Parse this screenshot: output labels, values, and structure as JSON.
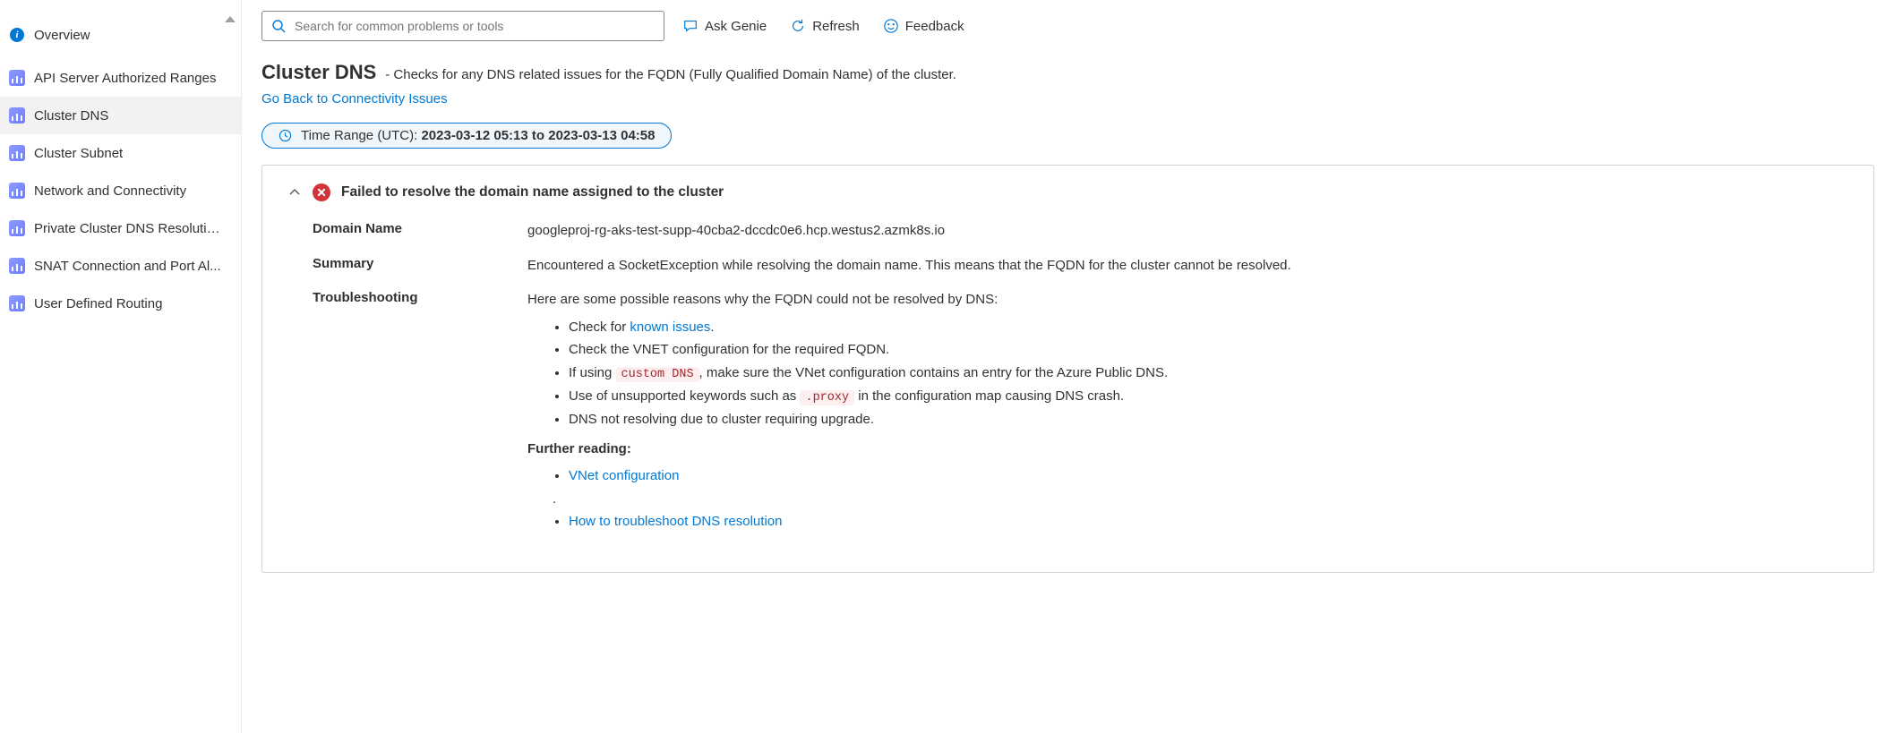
{
  "sidebar": {
    "overview": {
      "label": "Overview"
    },
    "items": [
      {
        "label": "API Server Authorized Ranges"
      },
      {
        "label": "Cluster DNS"
      },
      {
        "label": "Cluster Subnet"
      },
      {
        "label": "Network and Connectivity"
      },
      {
        "label": "Private Cluster DNS Resolutio..."
      },
      {
        "label": "SNAT Connection and Port Al..."
      },
      {
        "label": "User Defined Routing"
      }
    ],
    "selected_index": 1
  },
  "toolbar": {
    "search_placeholder": "Search for common problems or tools",
    "ask_genie": "Ask Genie",
    "refresh": "Refresh",
    "feedback": "Feedback"
  },
  "page": {
    "title": "Cluster DNS",
    "description": "-  Checks for any DNS related issues for the FQDN (Fully Qualified Domain Name) of the cluster.",
    "back_link": "Go Back to Connectivity Issues",
    "time_range_label": "Time Range (UTC): ",
    "time_range_value": "2023-03-12 05:13 to 2023-03-13 04:58"
  },
  "panel": {
    "title": "Failed to resolve the domain name assigned to the cluster",
    "rows": {
      "domain_name": {
        "label": "Domain Name",
        "value": "googleproj-rg-aks-test-supp-40cba2-dccdc0e6.hcp.westus2.azmk8s.io"
      },
      "summary": {
        "label": "Summary",
        "value": "Encountered a SocketException while resolving the domain name. This means that the FQDN for the cluster cannot be resolved."
      },
      "troubleshooting": {
        "label": "Troubleshooting",
        "intro": "Here are some possible reasons why the FQDN could not be resolved by DNS:",
        "bullets": {
          "b1_pre": "Check for ",
          "b1_link": "known issues",
          "b1_post": ".",
          "b2": "Check the VNET configuration for the required FQDN.",
          "b3_pre": "If using ",
          "b3_code": "custom DNS",
          "b3_post": ", make sure the VNet configuration contains an entry for the Azure Public DNS.",
          "b4_pre": "Use of unsupported keywords such as ",
          "b4_code": ".proxy",
          "b4_post": " in the configuration map causing DNS crash.",
          "b5": "DNS not resolving due to cluster requiring upgrade."
        },
        "further_heading": "Further reading:",
        "links": {
          "l1": "VNet configuration",
          "lsep": ".",
          "l2": "How to troubleshoot DNS resolution"
        }
      }
    }
  }
}
